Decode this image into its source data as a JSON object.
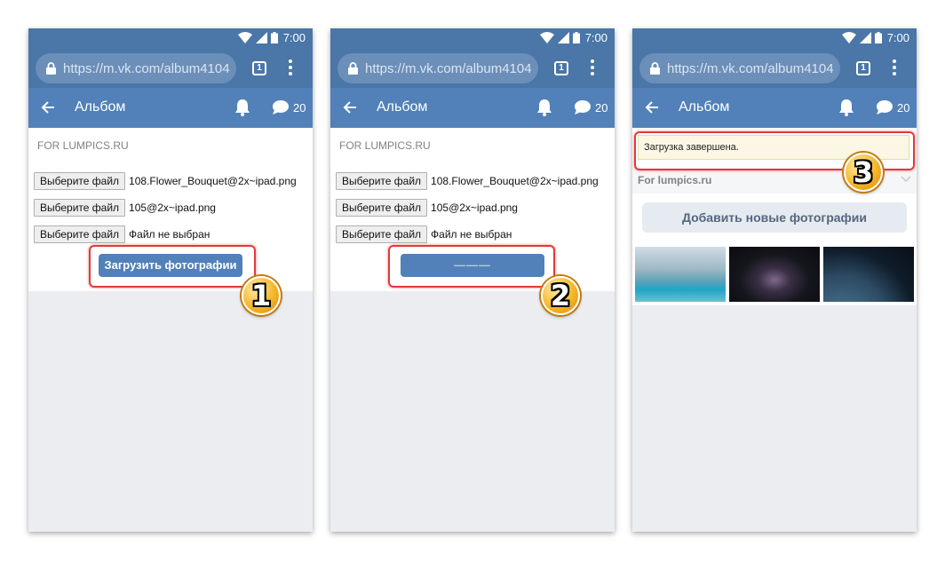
{
  "status": {
    "time": "7:00"
  },
  "browser": {
    "url": "https://m.vk.com/album4104",
    "tab_count": "1"
  },
  "app_bar": {
    "title": "Альбом",
    "message_count": "20"
  },
  "form": {
    "album_label": "FOR LUMPICS.RU",
    "choose_file_label": "Выберите файл",
    "file_1": "108.Flower_Bouquet@2x~ipad.png",
    "file_2": "105@2x~ipad.png",
    "file_3": "Файл не выбран",
    "upload_label": "Загрузить фотографии",
    "uploading_label": "———"
  },
  "result": {
    "notice": "Загрузка завершена.",
    "album_title": "For lumpics.ru",
    "add_photos_label": "Добавить новые фотографии"
  },
  "steps": [
    "1",
    "2",
    "3"
  ],
  "colors": {
    "vk_blue": "#5181b8",
    "status_blue": "#4a76a8",
    "highlight_red": "#e23a3a",
    "badge_gold": "#f5b728"
  }
}
